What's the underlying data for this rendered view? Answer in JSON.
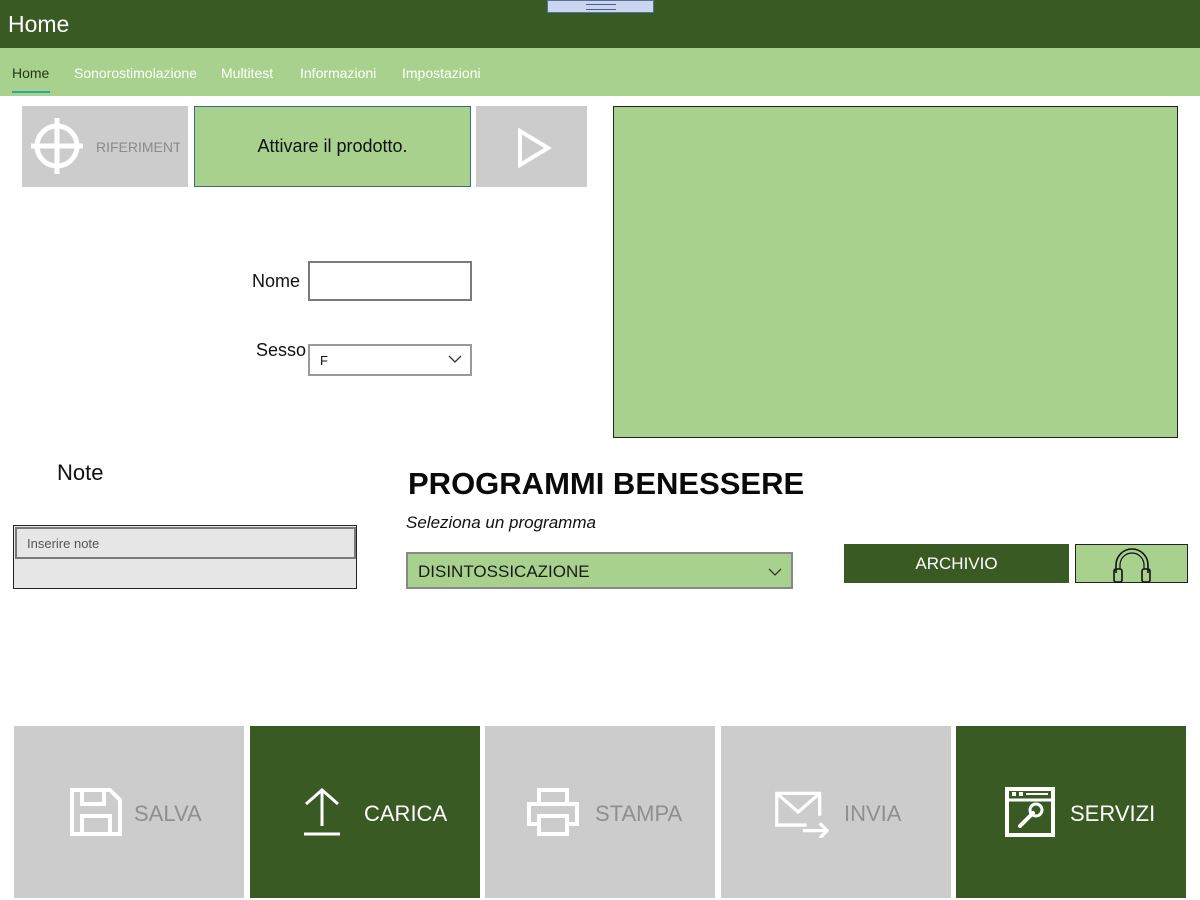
{
  "window": {
    "title": "Home"
  },
  "nav": {
    "items": [
      {
        "label": "Home",
        "active": true
      },
      {
        "label": "Sonorostimolazione"
      },
      {
        "label": "Multitest"
      },
      {
        "label": "Informazioni"
      },
      {
        "label": "Impostazioni"
      }
    ]
  },
  "toolbar": {
    "riferimento_label": "RIFERIMENTO",
    "activate_label": "Attivare il prodotto.",
    "play_icon": "play-icon",
    "riferimento_icon": "crosshair-icon"
  },
  "form": {
    "nome_label": "Nome",
    "nome_value": "",
    "sesso_label": "Sesso",
    "sesso_value": "F"
  },
  "notes": {
    "label": "Note",
    "placeholder": "Inserire note"
  },
  "programs": {
    "heading": "PROGRAMMI BENESSERE",
    "subheading": "Seleziona un programma",
    "selected": "DISINTOSSICAZIONE",
    "archivio_label": "ARCHIVIO",
    "headphones_icon": "headphones-icon"
  },
  "actions": {
    "salva": "SALVA",
    "carica": "CARICA",
    "stampa": "STAMPA",
    "invia": "INVIA",
    "servizi": "SERVIZI"
  },
  "colors": {
    "dark_green": "#3a5a23",
    "light_green": "#a8d18e",
    "gray": "#cccccc",
    "accent_underline": "#2ba7a0"
  }
}
